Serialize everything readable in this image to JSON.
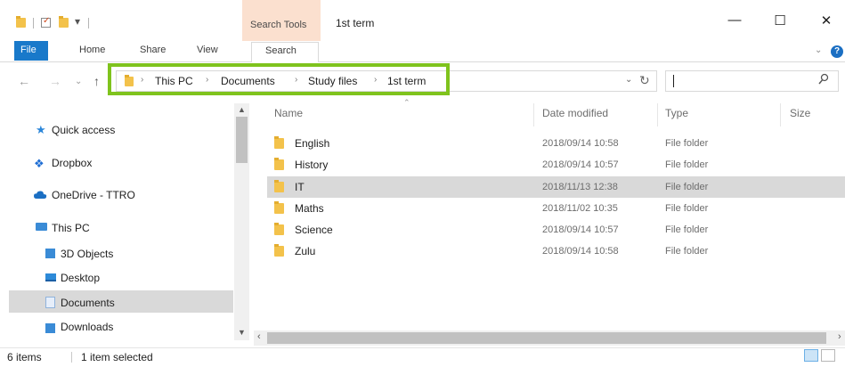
{
  "window": {
    "title": "1st term",
    "minimize_glyph": "—",
    "maximize_glyph": "☐",
    "close_glyph": "✕"
  },
  "ribbon": {
    "context_group": "Search Tools",
    "tabs": [
      "File",
      "Home",
      "Share",
      "View",
      "Search"
    ]
  },
  "address": {
    "crumbs": [
      "This PC",
      "Documents",
      "Study files",
      "1st term"
    ],
    "search_placeholder": ""
  },
  "nav": {
    "items": [
      "Quick access",
      "Dropbox",
      "OneDrive - TTRO",
      "This PC",
      "3D Objects",
      "Desktop",
      "Documents",
      "Downloads"
    ],
    "selected": "Documents"
  },
  "columns": [
    "Name",
    "Date modified",
    "Type",
    "Size"
  ],
  "files": [
    {
      "name": "English",
      "date": "2018/09/14 10:58",
      "type": "File folder"
    },
    {
      "name": "History",
      "date": "2018/09/14 10:57",
      "type": "File folder"
    },
    {
      "name": "IT",
      "date": "2018/11/13 12:38",
      "type": "File folder"
    },
    {
      "name": "Maths",
      "date": "2018/11/02 10:35",
      "type": "File folder"
    },
    {
      "name": "Science",
      "date": "2018/09/14 10:57",
      "type": "File folder"
    },
    {
      "name": "Zulu",
      "date": "2018/09/14 10:58",
      "type": "File folder"
    }
  ],
  "selected_file": "IT",
  "status": {
    "count": "6 items",
    "selection": "1 item selected"
  },
  "colors": {
    "accent": "#1979ca",
    "highlight_border": "#7fc31d",
    "context_tab": "#fbe0cf",
    "folder": "#f3c24b",
    "selection": "#d9d9d9"
  }
}
